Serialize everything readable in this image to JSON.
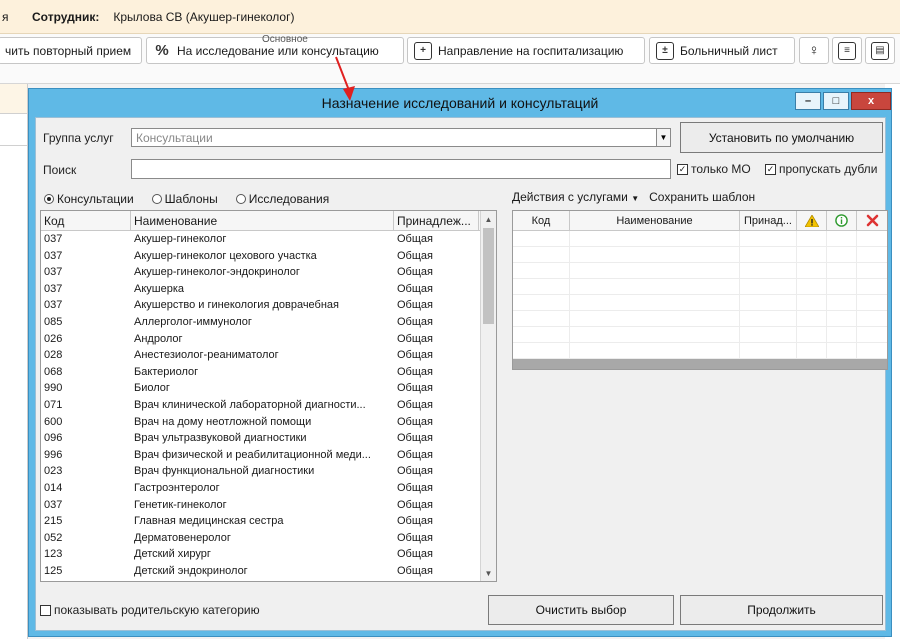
{
  "topbar": {
    "menu": "я",
    "employee_label": "Сотрудник:",
    "employee_value": "Крылова СВ (Акушер-гинеколог)"
  },
  "ribbon": {
    "buttons": [
      "чить повторный прием",
      "На исследование или консультацию",
      "Направление на госпитализацию",
      "Больничный лист"
    ],
    "group_label": "Основное"
  },
  "dialog": {
    "title": "Назначение исследований и консультаций",
    "window_controls": {
      "minimize": "–",
      "maximize": "□",
      "close": "x"
    },
    "service_group_label": "Группа услуг",
    "service_group_value": "Консультации",
    "set_default_button": "Установить по умолчанию",
    "search_label": "Поиск",
    "search_value": "",
    "only_mo_label": "только МО",
    "skip_dups_label": "пропускать дубли",
    "radios": [
      "Консультации",
      "Шаблоны",
      "Исследования"
    ],
    "left_columns": [
      "Код",
      "Наименование",
      "Принадлеж..."
    ],
    "rows": [
      {
        "code": "037",
        "name": "Акушер-гинеколог",
        "owner": "Общая"
      },
      {
        "code": "037",
        "name": "Акушер-гинеколог цехового участка",
        "owner": "Общая"
      },
      {
        "code": "037",
        "name": "Акушер-гинеколог-эндокринолог",
        "owner": "Общая"
      },
      {
        "code": "037",
        "name": "Акушерка",
        "owner": "Общая"
      },
      {
        "code": "037",
        "name": "Акушерство и гинекология доврачебная",
        "owner": "Общая"
      },
      {
        "code": "085",
        "name": "Аллерголог-иммунолог",
        "owner": "Общая"
      },
      {
        "code": "026",
        "name": "Андролог",
        "owner": "Общая"
      },
      {
        "code": "028",
        "name": "Анестезиолог-реаниматолог",
        "owner": "Общая"
      },
      {
        "code": "068",
        "name": "Бактериолог",
        "owner": "Общая"
      },
      {
        "code": "990",
        "name": "Биолог",
        "owner": "Общая"
      },
      {
        "code": "071",
        "name": "Врач клинической лабораторной диагности...",
        "owner": "Общая"
      },
      {
        "code": "600",
        "name": "Врач на дому неотложной помощи",
        "owner": "Общая"
      },
      {
        "code": "096",
        "name": "Врач ультразвуковой диагностики",
        "owner": "Общая"
      },
      {
        "code": "996",
        "name": "Врач физической и реабилитационной меди...",
        "owner": "Общая"
      },
      {
        "code": "023",
        "name": "Врач функциональной диагностики",
        "owner": "Общая"
      },
      {
        "code": "014",
        "name": "Гастроэнтеролог",
        "owner": "Общая"
      },
      {
        "code": "037",
        "name": "Генетик-гинеколог",
        "owner": "Общая"
      },
      {
        "code": "215",
        "name": "Главная медицинская сестра",
        "owner": "Общая"
      },
      {
        "code": "052",
        "name": "Дерматовенеролог",
        "owner": "Общая"
      },
      {
        "code": "123",
        "name": "Детский хирург",
        "owner": "Общая"
      },
      {
        "code": "125",
        "name": "Детский эндокринолог",
        "owner": "Общая"
      }
    ],
    "right_toolbar": {
      "actions": "Действия с услугами",
      "save_template": "Сохранить шаблон"
    },
    "right_columns": [
      "Код",
      "Наименование",
      "Принад..."
    ],
    "show_parent_label": "показывать родительскую категорию",
    "clear_button": "Очистить выбор",
    "continue_button": "Продолжить"
  }
}
